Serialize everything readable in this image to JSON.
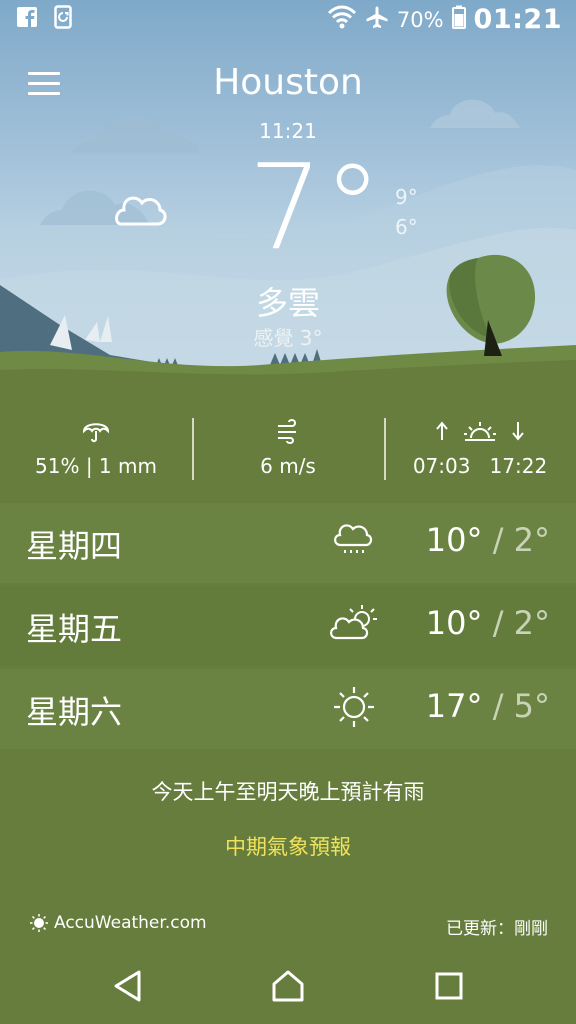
{
  "status_bar": {
    "battery_percent": "70%",
    "clock": "01:21",
    "icons": [
      "facebook-icon",
      "notification-icon",
      "wifi-icon",
      "airplane-icon",
      "battery-icon"
    ]
  },
  "header": {
    "city": "Houston",
    "time": "11:21"
  },
  "current": {
    "temperature": "7°",
    "high": "9°",
    "low": "6°",
    "condition": "多雲",
    "feels_like": "感覺 3°"
  },
  "stats": {
    "precipitation": "51% | 1 mm",
    "wind": "6 m/s",
    "sunrise": "07:03",
    "sunset": "17:22"
  },
  "forecast": [
    {
      "day": "星期四",
      "high": "10°",
      "low": "/ 2°",
      "icon": "rain-cloud-icon"
    },
    {
      "day": "星期五",
      "high": "10°",
      "low": "/ 2°",
      "icon": "partly-cloudy-icon"
    },
    {
      "day": "星期六",
      "high": "17°",
      "low": "/ 5°",
      "icon": "sun-icon"
    }
  ],
  "summary": "今天上午至明天晚上預計有雨",
  "mid_range_link": "中期氣象預報",
  "footer": {
    "brand": "AccuWeather.com",
    "updated": "已更新：剛剛"
  },
  "colors": {
    "grass": "#667d3d",
    "row_light": "#6b8342",
    "row_dark": "#627a3a",
    "link_yellow": "#f0e25d"
  }
}
